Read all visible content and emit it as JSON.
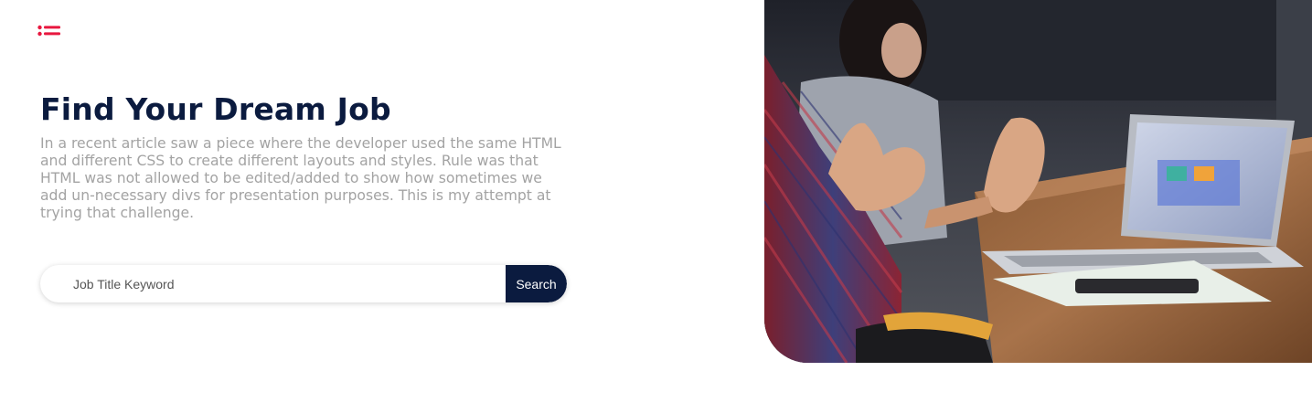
{
  "header": {
    "menu_icon": "list-icon",
    "accent_color": "#e8173f"
  },
  "hero": {
    "title": "Find Your Dream Job",
    "description": "In a recent article saw a piece where the developer used the same HTML and different CSS to create different layouts and styles. Rule was that HTML was not allowed to be edited/added to show how sometimes we add un-necessary divs for presentation purposes. This is my attempt at trying that challenge.",
    "title_color": "#0b1b3f",
    "text_color": "#a3a3a3"
  },
  "search": {
    "placeholder": "Job Title Keyword",
    "value": "",
    "button_label": "Search",
    "button_color": "#0b1b3f"
  },
  "image": {
    "description_icon": "office-meeting-photo"
  }
}
